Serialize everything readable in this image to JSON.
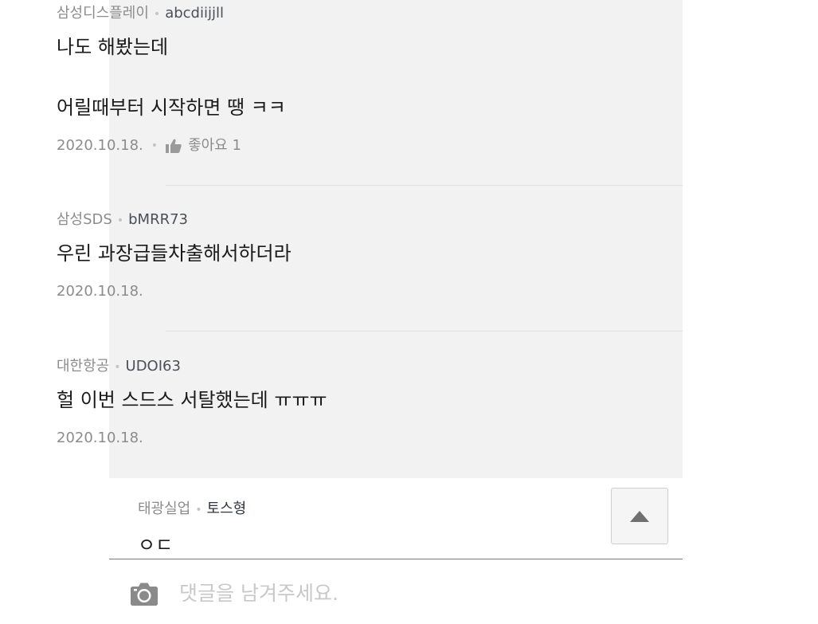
{
  "replies": [
    {
      "company": "삼성디스플레이",
      "nickname": "abcdiijjll",
      "line1": "나도 해봤는데",
      "line2": "어릴때부터 시작하면 땡 ㅋㅋ",
      "date": "2020.10.18.",
      "like_label": "좋아요 1"
    },
    {
      "company": "삼성SDS",
      "nickname": "bMRR73",
      "text": "우린 과장급들차출해서하더라",
      "date": "2020.10.18."
    },
    {
      "company": "대한항공",
      "nickname": "UDOI63",
      "text": "헐 이번 스드스 서탈했는데 ㅠㅠㅠ",
      "date": "2020.10.18."
    }
  ],
  "main_comment": {
    "company": "태광실업",
    "nickname": "토스형",
    "text": "ㅇㄷ"
  },
  "comment_input": {
    "placeholder": "댓글을 남겨주세요."
  },
  "icons": {
    "like": "thumbs-up-icon",
    "scroll_top": "triangle-up-icon",
    "camera": "camera-icon"
  },
  "colors": {
    "reply_background": "#f2f2f2",
    "meta_text": "#8c8c8c",
    "body_text": "#1a1a1a"
  }
}
